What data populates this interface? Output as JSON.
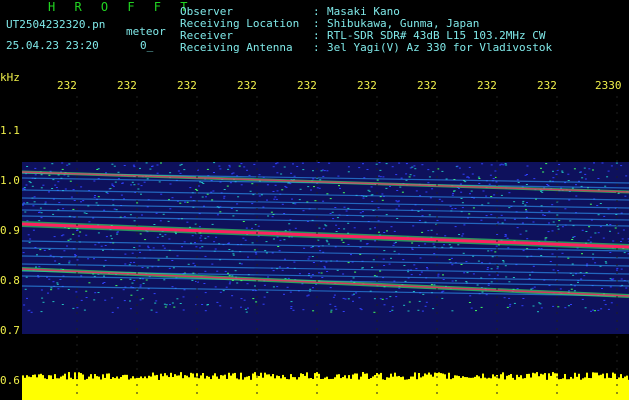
{
  "header": {
    "brand": "H R O F F T",
    "filename": "UT2504232320.pn",
    "station_type": "meteor",
    "datetime": "25.04.23 23:20",
    "index": "0_",
    "info": [
      {
        "label": "Observer",
        "value": "Masaki Kano"
      },
      {
        "label": "Receiving Location",
        "value": "Shibukawa, Gunma, Japan"
      },
      {
        "label": "Receiver",
        "value": "RTL-SDR SDR# 43dB L15 103.2MHz CW"
      },
      {
        "label": "Receiving Antenna",
        "value": "3el Yagi(V) Az 330 for Vladivostok"
      }
    ],
    "separator": ":"
  },
  "axis": {
    "unit": "kHz",
    "time_ticks": [
      "232",
      "232",
      "232",
      "232",
      "232",
      "232",
      "232",
      "232",
      "232",
      "2330"
    ],
    "freq_ticks": [
      "1.1",
      "1.0",
      "0.9",
      "0.8",
      "0.7",
      "0.6"
    ]
  },
  "colors": {
    "text_green": "#21d421",
    "text_cyan": "#7fe8e8",
    "tick_yellow": "#f0f04a",
    "bg_blue": "#1a1fa8",
    "signal_red": "#ff2060",
    "signal_green": "#40ff60",
    "power_yellow": "#ffff00"
  }
}
